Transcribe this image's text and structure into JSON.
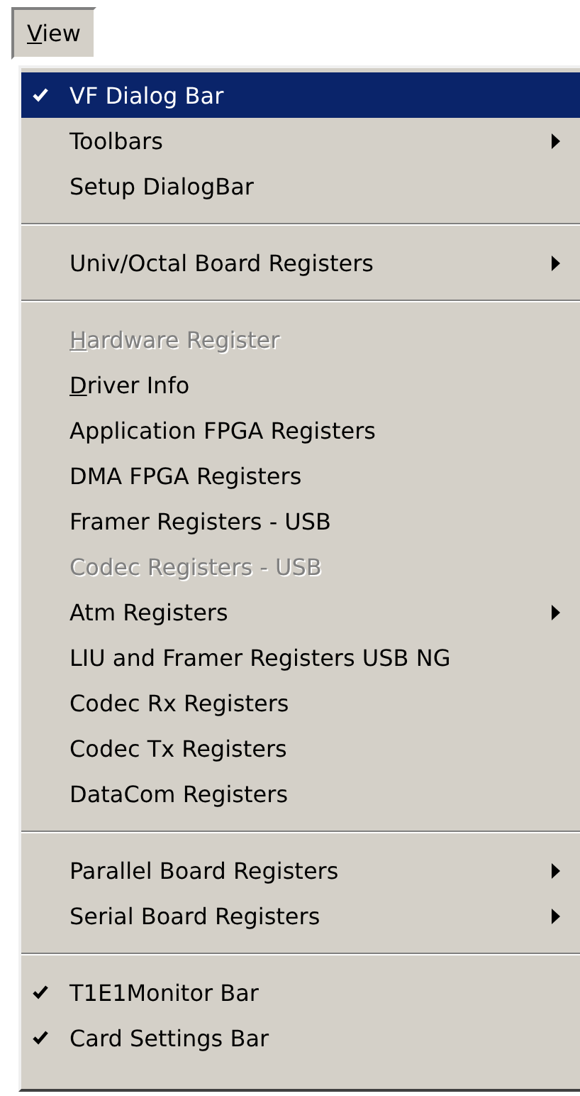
{
  "menu_bar": [
    {
      "label": "View",
      "underline_first": true,
      "selected": true
    }
  ],
  "menu": [
    {
      "kind": "item",
      "label": "VF Dialog Bar",
      "checked": true,
      "selected": true,
      "disabled": false,
      "submenu": false,
      "underline_first": false
    },
    {
      "kind": "item",
      "label": "Toolbars",
      "checked": false,
      "selected": false,
      "disabled": false,
      "submenu": true,
      "underline_first": false
    },
    {
      "kind": "item",
      "label": "Setup DialogBar",
      "checked": false,
      "selected": false,
      "disabled": false,
      "submenu": false,
      "underline_first": false
    },
    {
      "kind": "separator"
    },
    {
      "kind": "item",
      "label": "Univ/Octal Board Registers",
      "checked": false,
      "selected": false,
      "disabled": false,
      "submenu": true,
      "underline_first": false
    },
    {
      "kind": "separator"
    },
    {
      "kind": "item",
      "label": "Hardware Register",
      "checked": false,
      "selected": false,
      "disabled": true,
      "submenu": false,
      "underline_first": true
    },
    {
      "kind": "item",
      "label": "Driver Info",
      "checked": false,
      "selected": false,
      "disabled": false,
      "submenu": false,
      "underline_first": true
    },
    {
      "kind": "item",
      "label": "Application FPGA Registers",
      "checked": false,
      "selected": false,
      "disabled": false,
      "submenu": false,
      "underline_first": false
    },
    {
      "kind": "item",
      "label": "DMA FPGA Registers",
      "checked": false,
      "selected": false,
      "disabled": false,
      "submenu": false,
      "underline_first": false
    },
    {
      "kind": "item",
      "label": "Framer Registers - USB",
      "checked": false,
      "selected": false,
      "disabled": false,
      "submenu": false,
      "underline_first": false
    },
    {
      "kind": "item",
      "label": "Codec Registers - USB",
      "checked": false,
      "selected": false,
      "disabled": true,
      "submenu": false,
      "underline_first": false
    },
    {
      "kind": "item",
      "label": "Atm Registers",
      "checked": false,
      "selected": false,
      "disabled": false,
      "submenu": true,
      "underline_first": false
    },
    {
      "kind": "item",
      "label": "LIU and Framer Registers USB NG",
      "checked": false,
      "selected": false,
      "disabled": false,
      "submenu": false,
      "underline_first": false
    },
    {
      "kind": "item",
      "label": "Codec Rx Registers",
      "checked": false,
      "selected": false,
      "disabled": false,
      "submenu": false,
      "underline_first": false
    },
    {
      "kind": "item",
      "label": "Codec Tx Registers",
      "checked": false,
      "selected": false,
      "disabled": false,
      "submenu": false,
      "underline_first": false
    },
    {
      "kind": "item",
      "label": "DataCom Registers",
      "checked": false,
      "selected": false,
      "disabled": false,
      "submenu": false,
      "underline_first": false
    },
    {
      "kind": "separator"
    },
    {
      "kind": "item",
      "label": "Parallel Board Registers",
      "checked": false,
      "selected": false,
      "disabled": false,
      "submenu": true,
      "underline_first": false
    },
    {
      "kind": "item",
      "label": "Serial Board Registers",
      "checked": false,
      "selected": false,
      "disabled": false,
      "submenu": true,
      "underline_first": false
    },
    {
      "kind": "separator"
    },
    {
      "kind": "item",
      "label": "T1E1Monitor Bar",
      "checked": true,
      "selected": false,
      "disabled": false,
      "submenu": false,
      "underline_first": false
    },
    {
      "kind": "item",
      "label": "Card Settings Bar",
      "checked": true,
      "selected": false,
      "disabled": false,
      "submenu": false,
      "underline_first": false
    }
  ]
}
